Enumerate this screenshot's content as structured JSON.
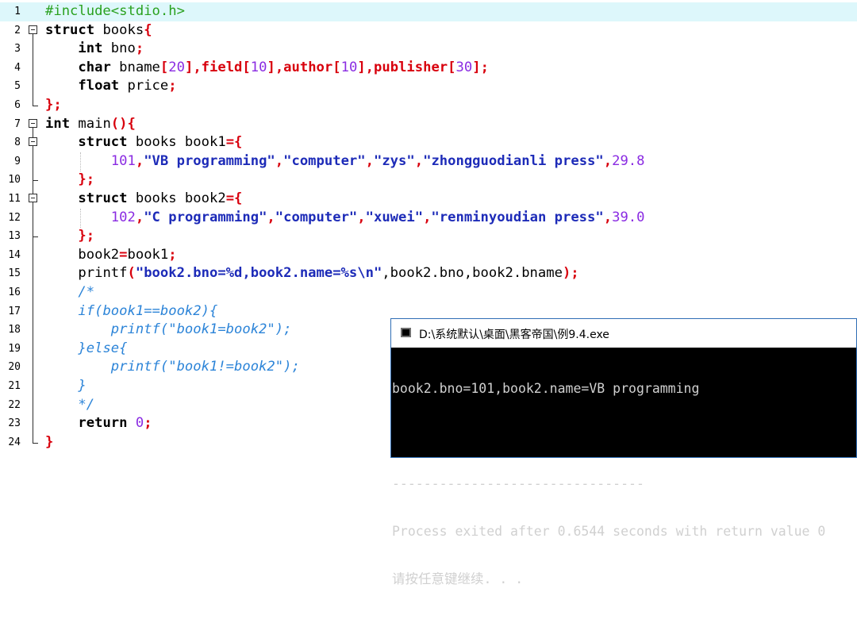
{
  "editor": {
    "line_numbers": [
      "1",
      "2",
      "3",
      "4",
      "5",
      "6",
      "7",
      "8",
      "9",
      "10",
      "11",
      "12",
      "13",
      "14",
      "15",
      "16",
      "17",
      "18",
      "19",
      "20",
      "21",
      "22",
      "23",
      "24"
    ],
    "lines": {
      "l1": "#include<stdio.h>",
      "l2a": "struct",
      "l2b": " books",
      "l2c": "{",
      "l3a": "int",
      "l3b": " bno",
      "l3c": ";",
      "l4a": "char",
      "l4b": " bname",
      "l4c": "[",
      "l4d": "20",
      "l4e": "],field",
      "l4f": "[",
      "l4g": "10",
      "l4h": "],author",
      "l4i": "[",
      "l4j": "10",
      "l4k": "],publisher",
      "l4l": "[",
      "l4m": "30",
      "l4n": "];",
      "l5a": "float",
      "l5b": " price",
      "l5c": ";",
      "l6": "};",
      "l7a": "int",
      "l7b": " main",
      "l7c": "(){",
      "l8a": "struct",
      "l8b": " books book1",
      "l8c": "={",
      "l9a": "101",
      "l9b": ",",
      "l9c": "\"VB programming\"",
      "l9d": ",",
      "l9e": "\"computer\"",
      "l9f": ",",
      "l9g": "\"zys\"",
      "l9h": ",",
      "l9i": "\"zhongguodianli press\"",
      "l9j": ",",
      "l9k": "29.8",
      "l10": "};",
      "l11a": "struct",
      "l11b": " books book2",
      "l11c": "={",
      "l12a": "102",
      "l12b": ",",
      "l12c": "\"C programming\"",
      "l12d": ",",
      "l12e": "\"computer\"",
      "l12f": ",",
      "l12g": "\"xuwei\"",
      "l12h": ",",
      "l12i": "\"renminyoudian press\"",
      "l12j": ",",
      "l12k": "39.0",
      "l13": "};",
      "l14a": "book2",
      "l14b": "=",
      "l14c": "book1",
      "l14d": ";",
      "l15a": "printf",
      "l15b": "(",
      "l15c": "\"book2.bno=%d,book2.name=%s\\n\"",
      "l15d": ",book2.bno,book2.bname",
      "l15e": ");",
      "l16": "/*",
      "l17": "if(book1==book2){",
      "l18": "printf(\"book1=book2\");",
      "l19": "}else{",
      "l20": "printf(\"book1!=book2\");",
      "l21": "}",
      "l22": "*/",
      "l23a": "return",
      "l23b": " 0",
      "l23c": ";",
      "l24": "}"
    }
  },
  "console": {
    "title": "D:\\系统默认\\桌面\\黑客帝国\\例9.4.exe",
    "output": [
      "book2.bno=101,book2.name=VB programming",
      "",
      "--------------------------------",
      "Process exited after 0.6544 seconds with return value 0",
      "请按任意键继续. . . "
    ]
  }
}
